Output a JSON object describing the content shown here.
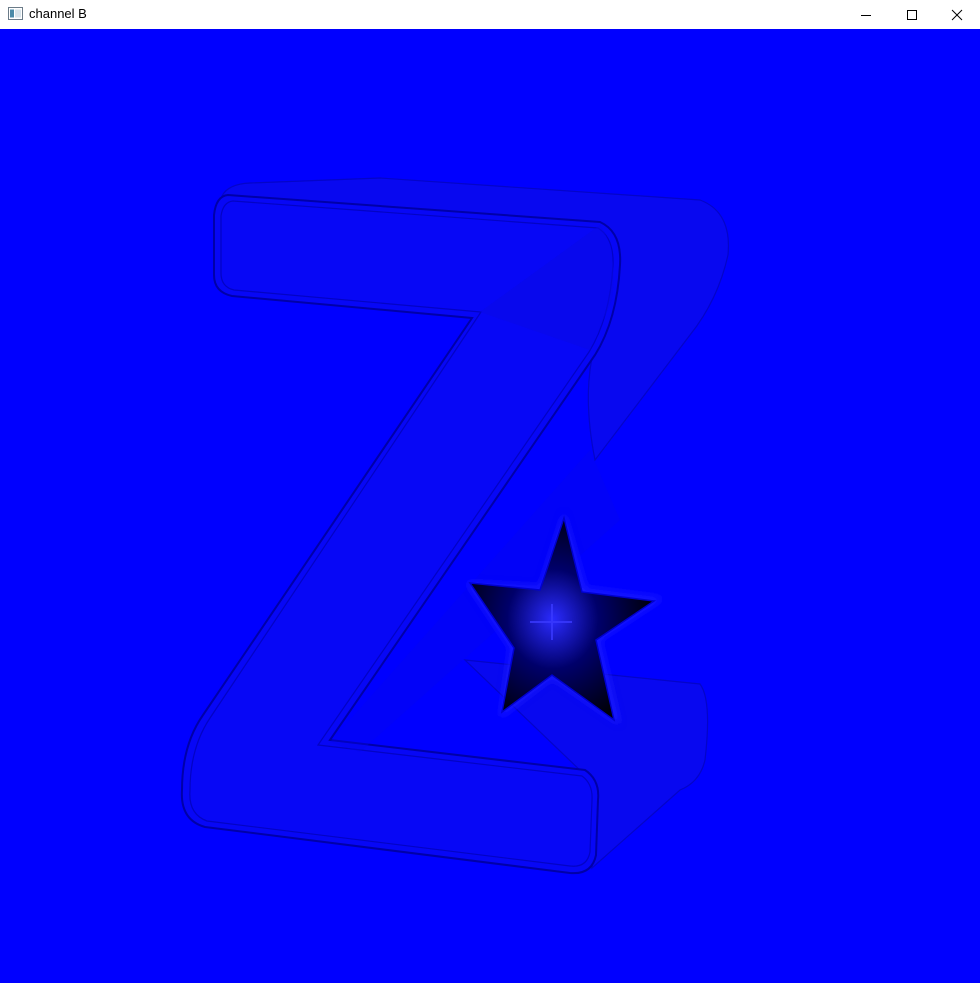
{
  "window": {
    "title": "channel B",
    "controls": {
      "minimize": "minimize-icon",
      "maximize": "maximize-icon",
      "close": "close-icon"
    }
  },
  "canvas": {
    "background": "#0000ff",
    "content": "3d-z-letter-with-star"
  },
  "colors": {
    "titlebar": "#ffffff",
    "channel_blue": "#0000ff",
    "outline_dark": "#0000a0",
    "star_core": "#000010"
  }
}
